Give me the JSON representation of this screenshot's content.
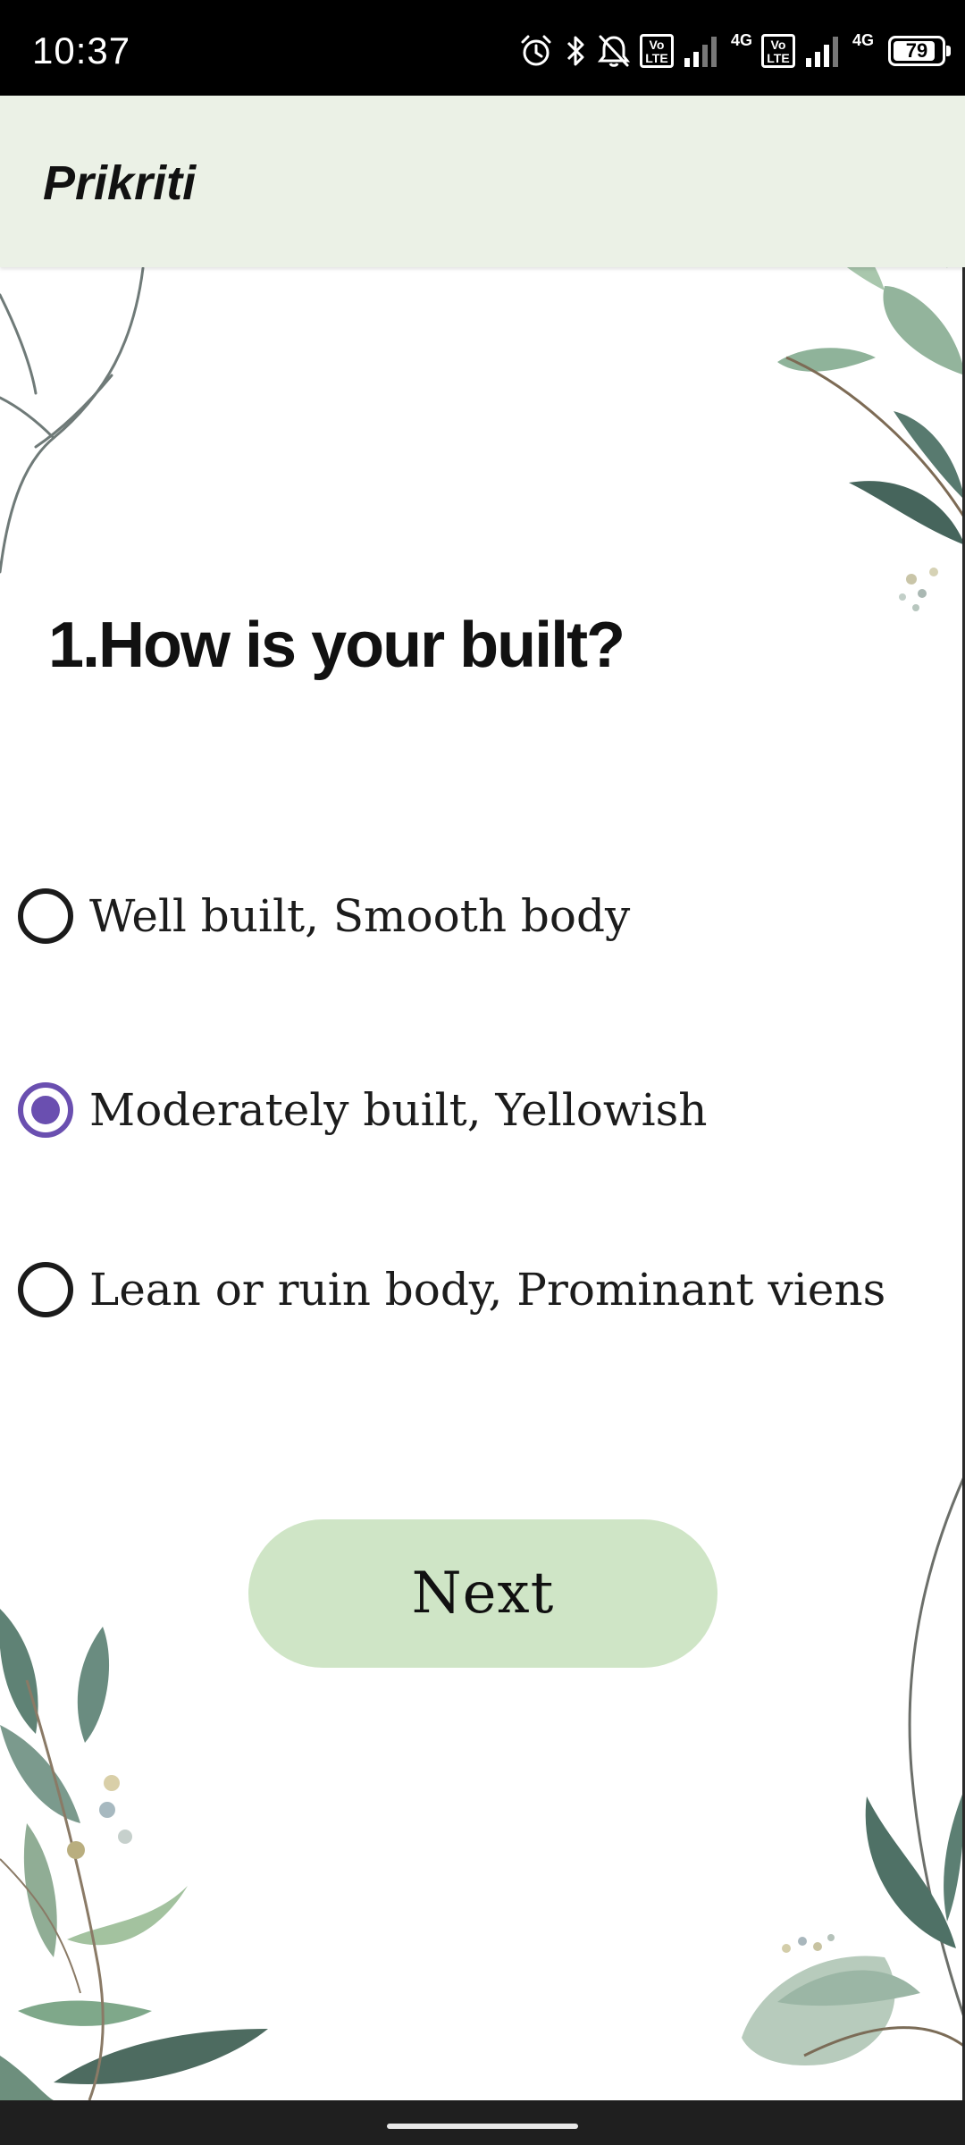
{
  "status_bar": {
    "time": "10:37",
    "battery": "79",
    "battery_level": 0.79,
    "network_labels": [
      "4G",
      "4G"
    ],
    "volte_badge": "Vo LTE",
    "icons": [
      "alarm-icon",
      "bluetooth-icon",
      "notifications-off-icon",
      "volte-icon",
      "signal-icon",
      "volte-icon",
      "signal-icon",
      "battery-icon"
    ]
  },
  "app_bar": {
    "title": "Prikriti",
    "background": "#ebf1e6"
  },
  "quiz": {
    "question": "1.How is your built?",
    "options": [
      {
        "label": "Well built, Smooth body",
        "checked": false
      },
      {
        "label": "Moderately built, Yellowish",
        "checked": true
      },
      {
        "label": "Lean or ruin body, Prominant viens",
        "checked": false
      }
    ],
    "selected_color": "#6a4fb0"
  },
  "next_button": {
    "label": "Next",
    "background": "#cfe5c6"
  }
}
